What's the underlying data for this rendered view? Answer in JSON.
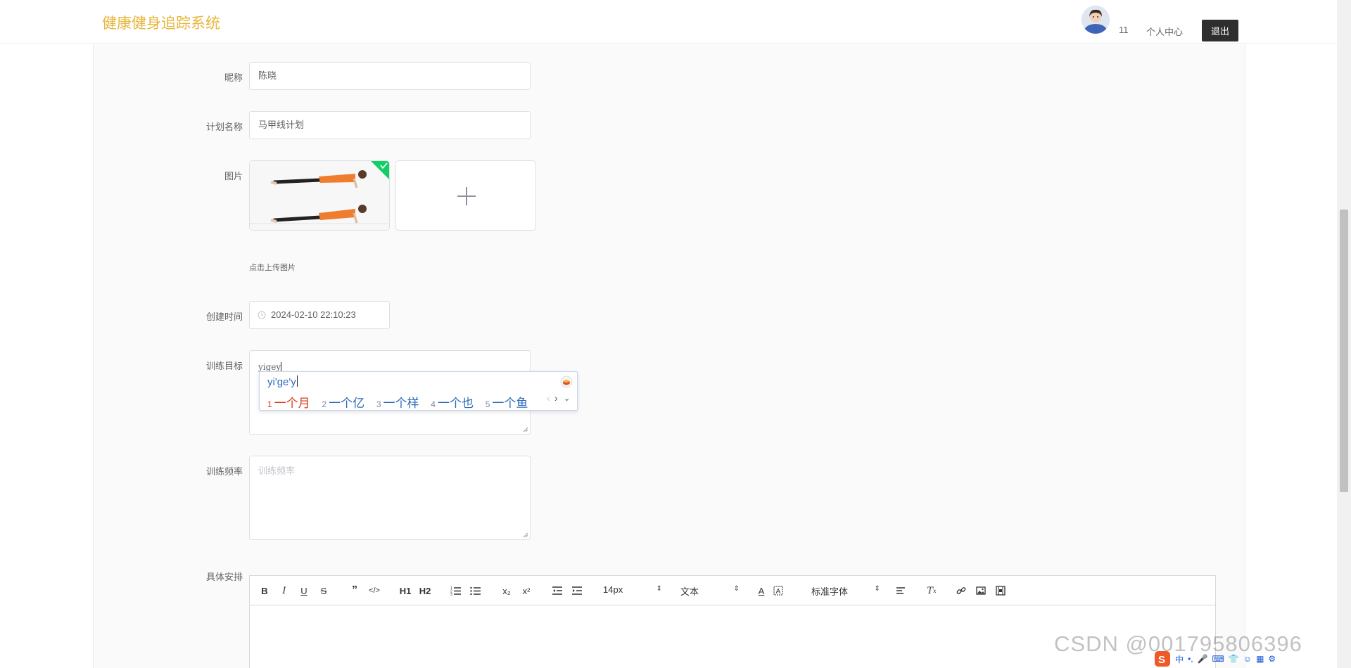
{
  "header": {
    "brand": "健康健身追踪系统",
    "user_count": "11",
    "profile_link": "个人中心",
    "logout": "退出"
  },
  "form": {
    "nickname_label": "昵称",
    "nickname_value": "陈晓",
    "plan_name_label": "计划名称",
    "plan_name_value": "马甲线计划",
    "image_label": "图片",
    "upload_hint": "点击上传图片",
    "created_label": "创建时间",
    "created_value": "2024-02-10 22:10:23",
    "goal_label": "训练目标",
    "goal_value": "yigey",
    "frequency_label": "训练频率",
    "frequency_placeholder": "训练频率",
    "schedule_label": "具体安排"
  },
  "ime": {
    "composition": "yi'ge'y",
    "candidates": [
      {
        "num": "1",
        "text": "一个月"
      },
      {
        "num": "2",
        "text": "一个亿"
      },
      {
        "num": "3",
        "text": "一个样"
      },
      {
        "num": "4",
        "text": "一个也"
      },
      {
        "num": "5",
        "text": "一个鱼"
      }
    ]
  },
  "editor": {
    "buttons": [
      "B",
      "I",
      "U",
      "S",
      "”",
      "</>",
      "H1",
      "H2",
      "ordered-list",
      "bullet-list",
      "x₂",
      "x²",
      "outdent",
      "indent"
    ],
    "size_select": "14px",
    "header_select": "文本",
    "font_select": "标准字体"
  },
  "watermark": "CSDN @001795806396",
  "colors": {
    "brand": "#e8b53a",
    "logout_bg": "#2e2e2e",
    "ime_candidate": "#2e6bb8",
    "ime_active": "#d9391c",
    "upload_badge": "#13ce66"
  }
}
